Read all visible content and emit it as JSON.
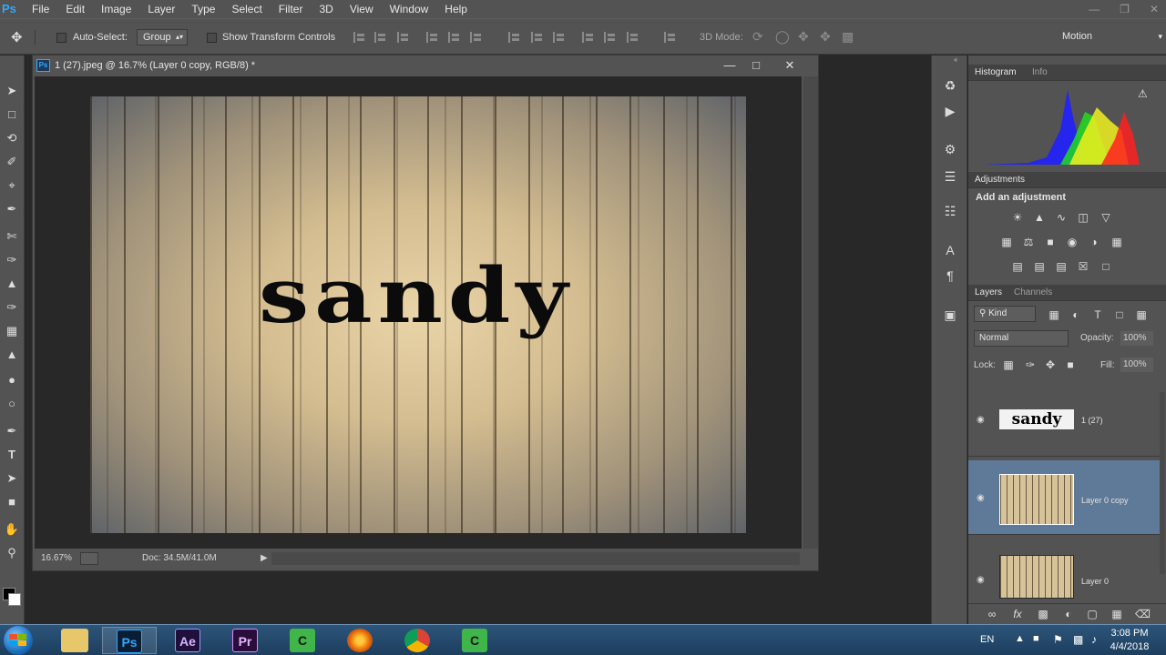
{
  "app": {
    "logo": "Ps"
  },
  "menu": [
    "File",
    "Edit",
    "Image",
    "Layer",
    "Type",
    "Select",
    "Filter",
    "3D",
    "View",
    "Window",
    "Help"
  ],
  "options": {
    "auto_select_label": "Auto-Select:",
    "auto_select_value": "Group",
    "show_transform_label": "Show Transform Controls",
    "mode_3d_label": "3D Mode:",
    "workspace": "Motion"
  },
  "document": {
    "title": "1 (27).jpeg @ 16.7% (Layer 0 copy, RGB/8) *",
    "canvas_text": "sandy",
    "zoom": "16.67%",
    "doc_size": "Doc: 34.5M/41.0M"
  },
  "histogram": {
    "tab_active": "Histogram",
    "tab_inactive": "Info"
  },
  "adjustments": {
    "title": "Adjustments",
    "subtitle": "Add an adjustment"
  },
  "layers_panel": {
    "tab_active": "Layers",
    "tab_inactive": "Channels",
    "filter_kind": "Kind",
    "blend_mode": "Normal",
    "opacity_label": "Opacity:",
    "opacity_value": "100%",
    "lock_label": "Lock:",
    "fill_label": "Fill:",
    "fill_value": "100%",
    "layers": [
      {
        "name": "1 (27)",
        "thumb_text": "sandy",
        "selected": false
      },
      {
        "name": "Layer 0 copy",
        "selected": true
      },
      {
        "name": "Layer 0",
        "selected": false
      }
    ]
  },
  "taskbar": {
    "apps": [
      {
        "name": "Explorer",
        "label": ""
      },
      {
        "name": "Photoshop",
        "label": "Ps",
        "color": "#31a8ff",
        "bg": "#0b1d33"
      },
      {
        "name": "After Effects",
        "label": "Ae",
        "color": "#d7b4ff",
        "bg": "#1f0f3a"
      },
      {
        "name": "Premiere",
        "label": "Pr",
        "color": "#e5b6ff",
        "bg": "#2a0d3a"
      },
      {
        "name": "Camtasia",
        "label": "C",
        "color": "#1a1a1a",
        "bg": "#3fb54a"
      },
      {
        "name": "Firefox",
        "label": "",
        "color": "#ffffff",
        "bg": "#e66000"
      },
      {
        "name": "Chrome",
        "label": "",
        "color": "#ffffff",
        "bg": "#db4437"
      },
      {
        "name": "Camtasia Recorder",
        "label": "C",
        "color": "#1a1a1a",
        "bg": "#3fb54a"
      }
    ],
    "language": "EN",
    "time": "3:08 PM",
    "date": "4/4/2018"
  }
}
